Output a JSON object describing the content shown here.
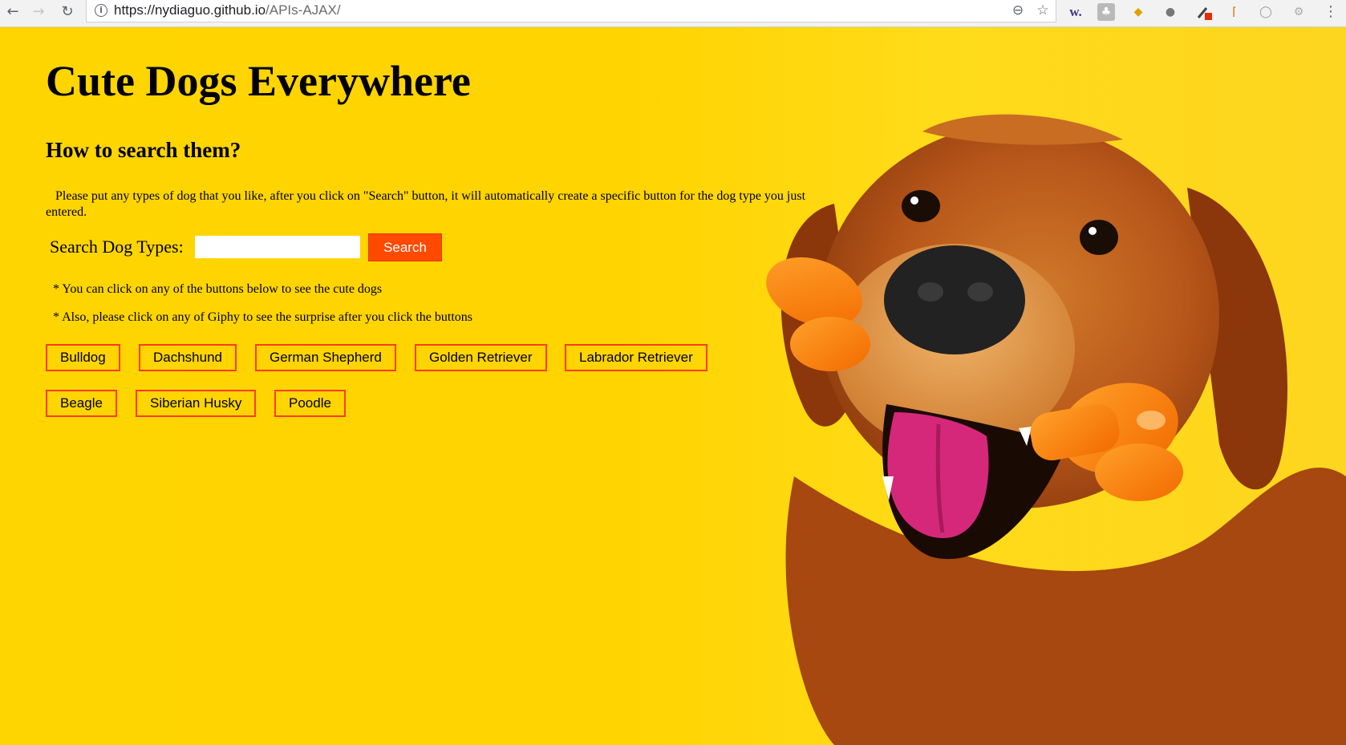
{
  "browser": {
    "url_host": "https://nydiaguo.github.io",
    "url_path": "/APIs-AJAX/"
  },
  "page": {
    "title": "Cute Dogs Everywhere",
    "subtitle": "How to search them?",
    "description": "Please put any types of dog that you like, after you click on \"Search\" button, it will automatically create a specific button for the dog type you just entered.",
    "search": {
      "label": "Search Dog Types:",
      "value": "",
      "button_label": "Search"
    },
    "notes": [
      "* You can click on any of the buttons below to see the cute dogs",
      "* Also, please click on any of Giphy to see the surprise after you click the buttons"
    ],
    "dog_buttons": [
      "Bulldog",
      "Dachshund",
      "German Shepherd",
      "Golden Retriever",
      "Labrador Retriever",
      "Beagle",
      "Siberian Husky",
      "Poodle"
    ]
  },
  "colors": {
    "background": "#ffd200",
    "accent": "#ff4a00",
    "button_border": "#ff3b1a"
  }
}
